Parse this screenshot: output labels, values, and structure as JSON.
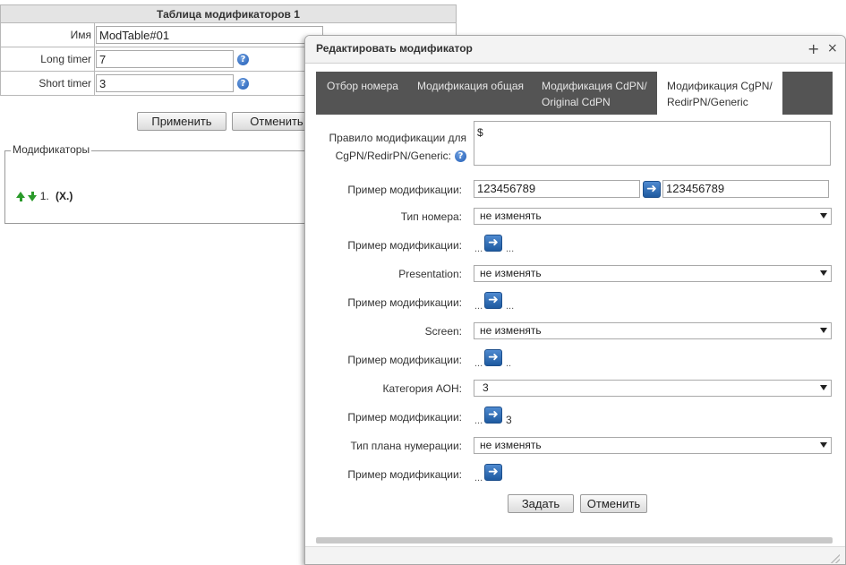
{
  "background": {
    "table_title": "Таблица модификаторов 1",
    "rows": [
      {
        "label": "Имя",
        "value": "ModTable#01",
        "help": false
      },
      {
        "label": "Long timer",
        "value": "7",
        "help": true
      },
      {
        "label": "Short timer",
        "value": "3",
        "help": true
      }
    ],
    "apply_label": "Применить",
    "cancel_label": "Отменить",
    "modifiers_legend": "Модификаторы",
    "modifier_item": {
      "index": "1.",
      "text": "(X.)"
    }
  },
  "dialog": {
    "title": "Редактировать модификатор",
    "tabs": [
      {
        "label": "Отбор номера"
      },
      {
        "label": "Модификация общая"
      },
      {
        "label": "Модификация CdPN/ Original CdPN"
      },
      {
        "label": "Модификация CgPN/ RedirPN/Generic"
      }
    ],
    "rule_label": "Правило модификации для CgPN/RedirPN/Generic:",
    "rule_value": "$",
    "example_label": "Пример модификации:",
    "example_input": "123456789",
    "example_output": "123456789",
    "number_type_label": "Тип номера:",
    "number_type_value": "не изменять",
    "presentation_label": "Presentation:",
    "presentation_value": "не изменять",
    "screen_label": "Screen:",
    "screen_value": "не изменять",
    "category_label": "Категория АОН:",
    "category_value": "3",
    "numbering_plan_label": "Тип плана нумерации:",
    "numbering_plan_value": "не изменять",
    "dots": "...",
    "examples": {
      "number_type_result": "...",
      "presentation_result": "...",
      "screen_result": "..",
      "category_result": "3",
      "numbering_plan_result": ""
    },
    "submit_label": "Задать",
    "cancel_label": "Отменить"
  },
  "icons": {
    "help": "question-circle-icon",
    "arrow": "arrow-right-icon",
    "close": "close-icon",
    "maximize": "plus-icon"
  },
  "colors": {
    "tab_bar": "#545454",
    "arrow_button": "#2e6bb5",
    "move_arrows": "#2a9a2a"
  }
}
